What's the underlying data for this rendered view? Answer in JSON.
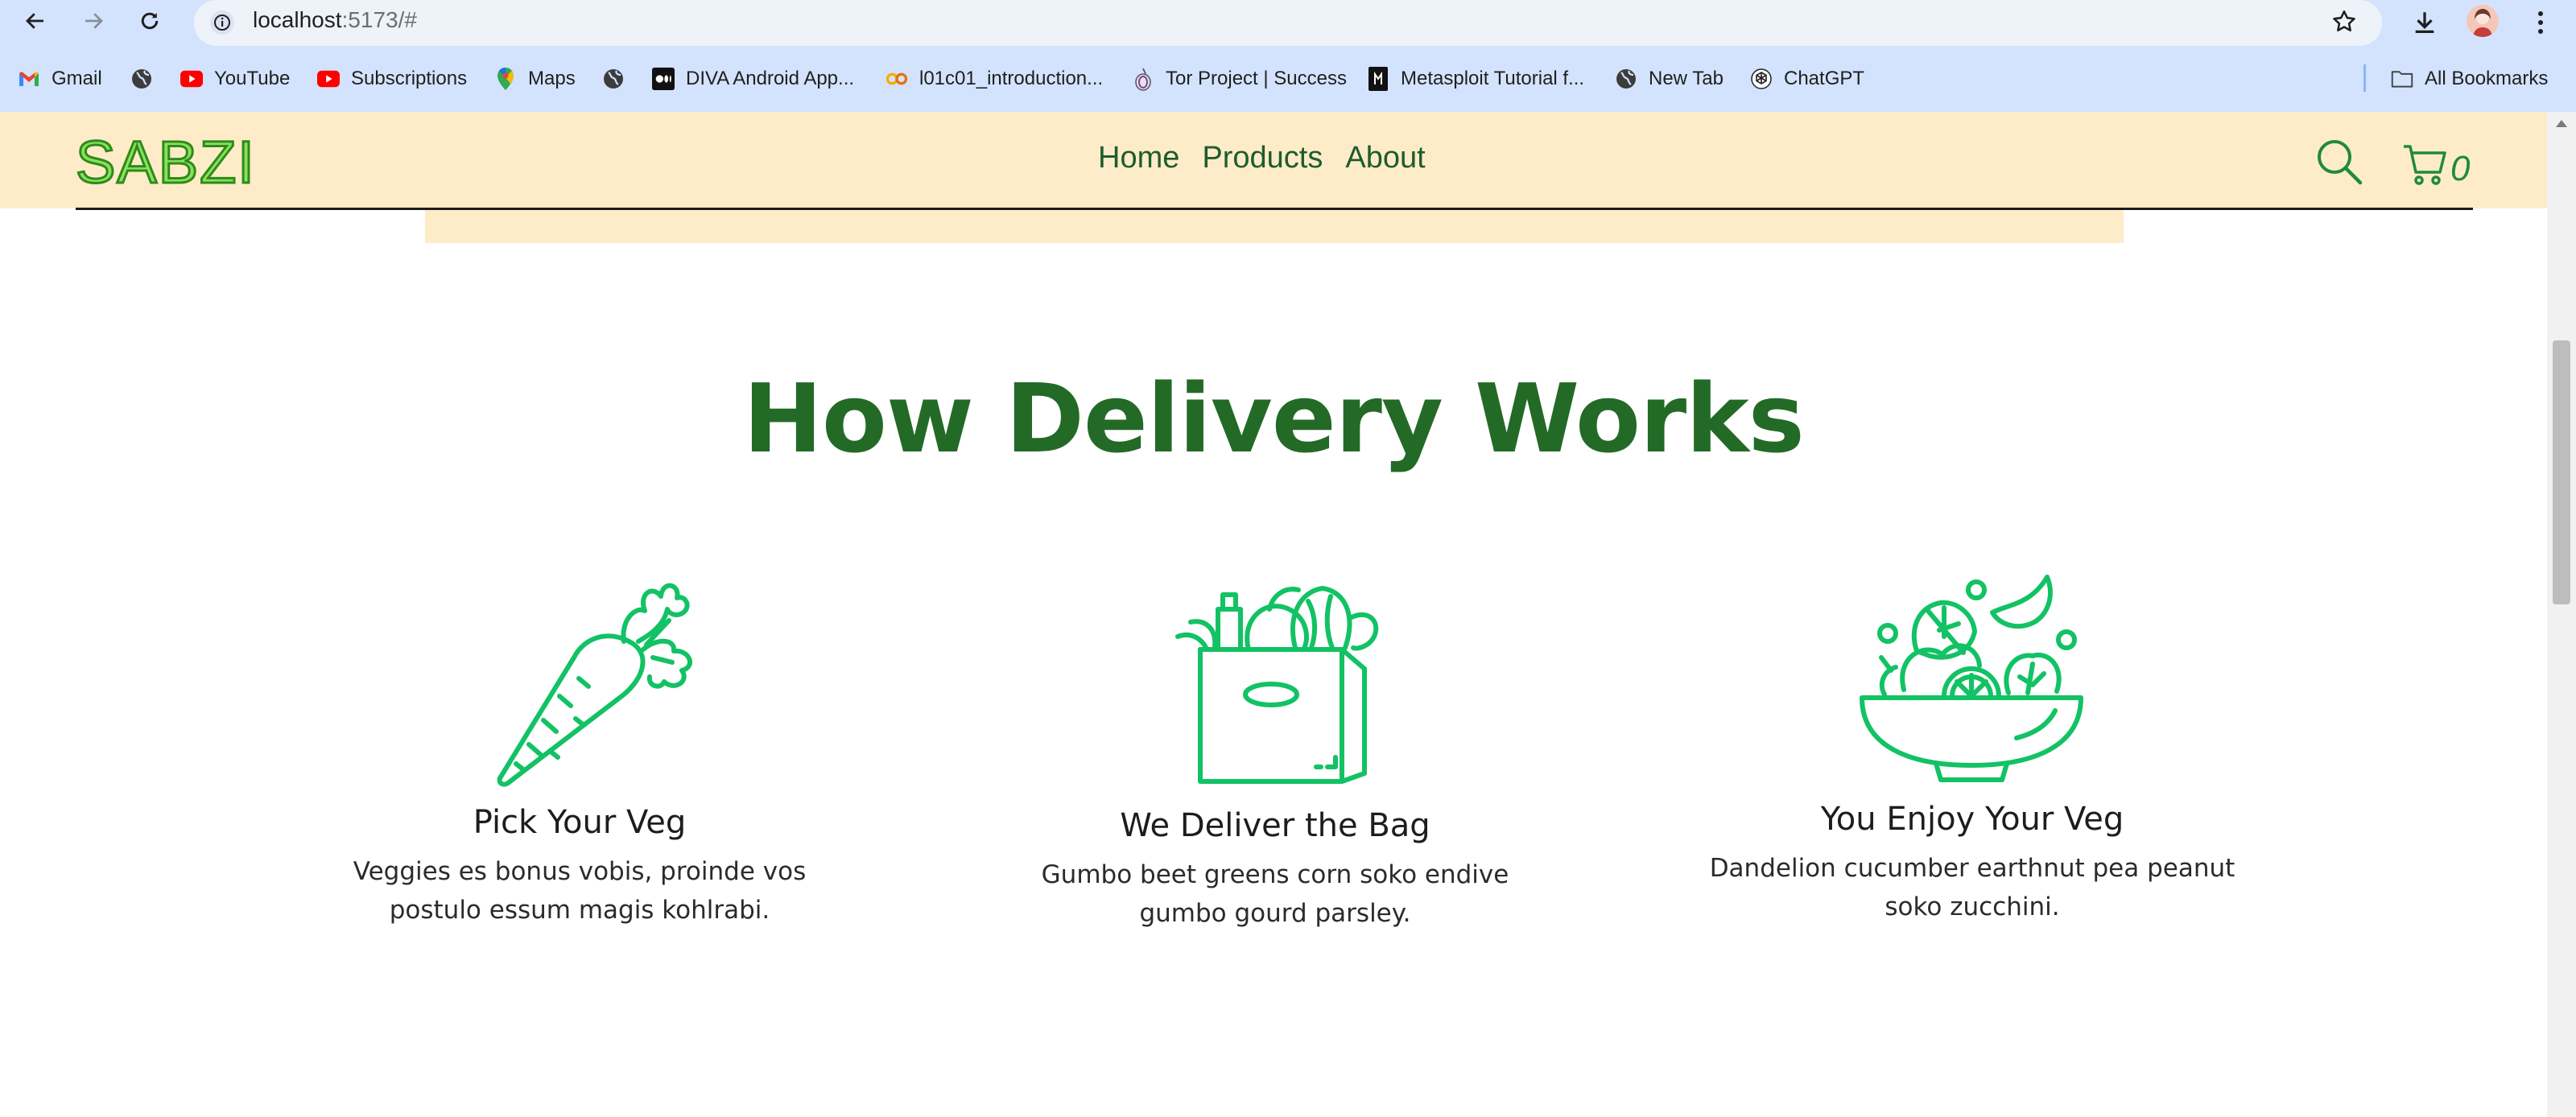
{
  "browser": {
    "url_host": "localhost",
    "url_path": ":5173/#",
    "bookmarks": [
      {
        "label": "Gmail",
        "icon": "gmail-icon"
      },
      {
        "label": "",
        "icon": "globe-icon"
      },
      {
        "label": "YouTube",
        "icon": "youtube-icon"
      },
      {
        "label": "Subscriptions",
        "icon": "youtube-icon"
      },
      {
        "label": "Maps",
        "icon": "maps-icon"
      },
      {
        "label": "",
        "icon": "globe-icon"
      },
      {
        "label": "DIVA Android App...",
        "icon": "medium-icon"
      },
      {
        "label": "l01c01_introduction...",
        "icon": "colab-icon"
      },
      {
        "label": "Tor Project | Success",
        "icon": "tor-icon"
      },
      {
        "label": "Metasploit Tutorial f...",
        "icon": "metasploit-icon"
      },
      {
        "label": "New Tab",
        "icon": "globe-icon"
      },
      {
        "label": "ChatGPT",
        "icon": "chatgpt-icon"
      }
    ],
    "all_bookmarks_label": "All Bookmarks"
  },
  "header": {
    "logo": "SABZI",
    "nav": [
      "Home",
      "Products",
      "About"
    ],
    "cart_count": "0"
  },
  "section": {
    "title": "How Delivery Works",
    "steps": [
      {
        "title": "Pick Your Veg",
        "text": "Veggies es bonus vobis, proinde vos postulo essum magis kohlrabi.",
        "icon": "carrot-icon"
      },
      {
        "title": "We Deliver the Bag",
        "text": "Gumbo beet greens corn soko endive gumbo gourd parsley.",
        "icon": "grocery-bag-icon"
      },
      {
        "title": "You Enjoy Your Veg",
        "text": "Dandelion cucumber earthnut pea peanut soko zucchini.",
        "icon": "salad-bowl-icon"
      }
    ]
  },
  "colors": {
    "chrome": "#d3e3fd",
    "header_bg": "#feecc8",
    "brand_green": "#236a27",
    "icon_green": "#12c264"
  }
}
